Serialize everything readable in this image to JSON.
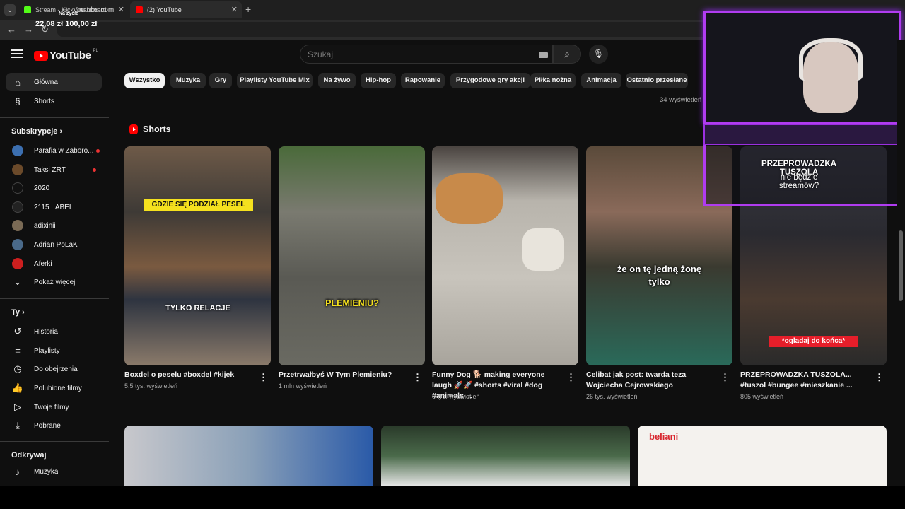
{
  "browser": {
    "tabs": [
      {
        "label": "Stream - Kick Dashboard",
        "favicon_color": "#53fc18",
        "active": false
      },
      {
        "label": "(2) YouTube",
        "favicon_color": "#ff0000",
        "active": true
      }
    ],
    "new_tab": "+",
    "url": "youtube.com"
  },
  "overlay": {
    "donation": "22,08 zł   100,00 zł",
    "live_label": "Na życie"
  },
  "header": {
    "logo_text": "YouTube",
    "logo_region": "PL",
    "search_placeholder": "Szukaj"
  },
  "sidebar": {
    "main": [
      {
        "label": "Główna",
        "icon": "home-icon"
      },
      {
        "label": "Shorts",
        "icon": "shorts-icon"
      }
    ],
    "subscriptions_title": "Subskrypcje",
    "subscriptions": [
      {
        "label": "Parafia w Zaboro...",
        "avatar_color": "#3c6fb0",
        "live": true
      },
      {
        "label": "Taksi ZRT",
        "avatar_color": "#6b4a2a",
        "live": true
      },
      {
        "label": "2020",
        "avatar_color": "#111111",
        "live": false
      },
      {
        "label": "2115 LABEL",
        "avatar_color": "#222222",
        "live": false
      },
      {
        "label": "adixinii",
        "avatar_color": "#7a6a55",
        "live": false
      },
      {
        "label": "Adrian PoLaK",
        "avatar_color": "#4a6a8a",
        "live": false
      },
      {
        "label": "Aferki",
        "avatar_color": "#cc1f1f",
        "live": false
      },
      {
        "label": "Pokaż więcej",
        "icon": "chevron-down-icon"
      }
    ],
    "you_title": "Ty",
    "you": [
      {
        "label": "Historia",
        "icon": "history-icon"
      },
      {
        "label": "Playlisty",
        "icon": "playlist-icon"
      },
      {
        "label": "Do obejrzenia",
        "icon": "clock-icon"
      },
      {
        "label": "Polubione filmy",
        "icon": "thumbs-up-icon"
      },
      {
        "label": "Twoje filmy",
        "icon": "video-icon"
      },
      {
        "label": "Pobrane",
        "icon": "download-icon"
      }
    ],
    "explore_title": "Odkrywaj",
    "explore": [
      {
        "label": "Muzyka",
        "icon": "music-icon"
      }
    ]
  },
  "chips": [
    "Wszystko",
    "Muzyka",
    "Gry",
    "Playlisty YouTube Mix",
    "Na żywo",
    "Hip-hop",
    "Rapowanie",
    "Przygodowe gry akcji",
    "Piłka nożna",
    "Animacja",
    "Ostatnio przesłane"
  ],
  "views_top": "34 wyświetleń",
  "shorts_title": "Shorts",
  "shorts": [
    {
      "title": "Boxdel o peselu #boxdel #kijek",
      "views": "5,5 tys. wyświetleń",
      "thumb_color": "#5a5040",
      "captions": [
        "GDZIE SIĘ PODZIAŁ PESEL",
        "TYLKO RELACJE"
      ]
    },
    {
      "title": "Przetrwałbyś W Tym Plemieniu?",
      "views": "1 mln wyświetleń",
      "thumb_color": "#6a6a60",
      "captions": [
        "PLEMIENIU?"
      ]
    },
    {
      "title": "Funny Dog 🐕 making everyone laugh 🚀🚀 #shorts #viral #dog #animals ...",
      "views": "6 tys. wyświetleń",
      "thumb_color": "#b8b4ac",
      "captions": []
    },
    {
      "title": "Celibat jak post: twarda teza Wojciecha Cejrowskiego",
      "views": "26 tys. wyświetleń",
      "thumb_color": "#3a3230",
      "captions": [
        "że on tę jedną żonę tylko"
      ]
    },
    {
      "title": "PRZEPROWADZKA TUSZOLA... #tuszol #bungee #mieszkanie ...",
      "views": "805 wyświetleń",
      "thumb_color": "#2c2a2e",
      "captions": [
        "PRZEPROWADZKA TUSZOLA",
        "nie będzie streamów?",
        "*oglądaj do końca*"
      ]
    }
  ],
  "videos": [
    {
      "thumb_color": "#8aa0b8"
    },
    {
      "thumb_color": "#3a4a3a"
    },
    {
      "thumb_color": "#f4f2ee",
      "brand": "beliani"
    }
  ]
}
